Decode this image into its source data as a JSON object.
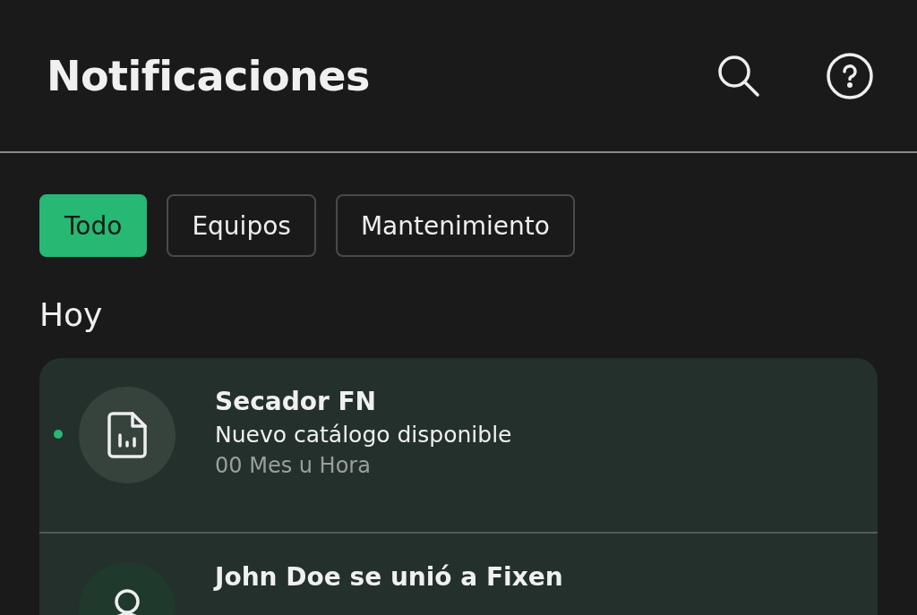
{
  "header": {
    "title": "Notificaciones"
  },
  "filters": [
    {
      "label": "Todo",
      "selected": true
    },
    {
      "label": "Equipos",
      "selected": false
    },
    {
      "label": "Mantenimiento",
      "selected": false
    }
  ],
  "section": {
    "title": "Hoy"
  },
  "notifications": [
    {
      "kind": "document",
      "unread": true,
      "title": "Secador FN",
      "message": "Nuevo catálogo disponible",
      "time": "00 Mes u Hora"
    },
    {
      "kind": "user",
      "unread": false,
      "title": "John Doe se unió a Fixen"
    }
  ]
}
